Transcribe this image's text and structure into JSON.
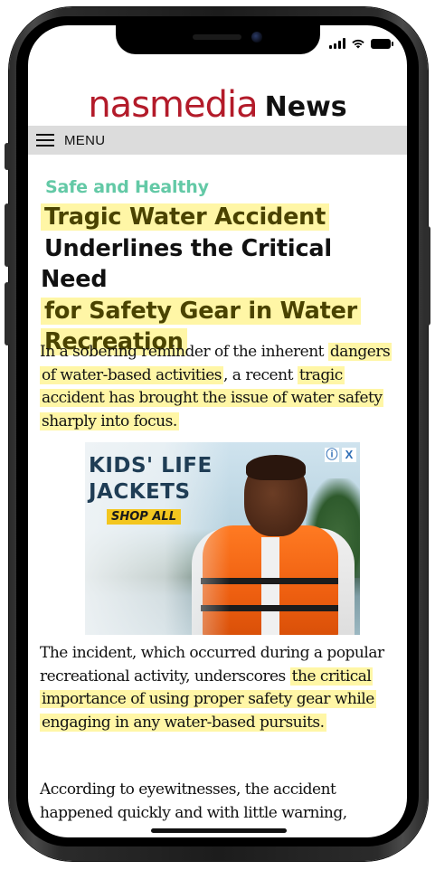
{
  "brand": {
    "name": "nasmedia",
    "section": "News"
  },
  "nav": {
    "menu_label": "MENU"
  },
  "article": {
    "category": "Safe and Healthy",
    "headline_lines": [
      "Tragic Water Accident",
      "Underlines the Critical Need",
      "for Safety Gear in Water",
      "Recreation"
    ],
    "para1": {
      "pre": "In a sobering reminder of the inherent ",
      "highlight_a": "dangers of water-based activities",
      "mid": ", a recent ",
      "highlight_b": "tragic accident has brought the issue of water safety sharply into focus."
    },
    "para2": {
      "pre": "The incident, which occurred during a popular recreational activity, underscores ",
      "highlight": "the critical importance of using proper safety gear while engaging in any water-based pursuits."
    },
    "para3": "According to eyewitnesses, the accident happened quickly and with little warning,"
  },
  "ad": {
    "title_line1": "KIDS' LIFE",
    "title_line2": "JACKETS",
    "cta": "SHOP ALL",
    "info_glyph": "ⓘ",
    "close_glyph": "X"
  },
  "colors": {
    "brand": "#b31b2a",
    "category": "#63c9a6",
    "highlight": "#fff6a6",
    "menu_bar": "#dcdcdc"
  }
}
